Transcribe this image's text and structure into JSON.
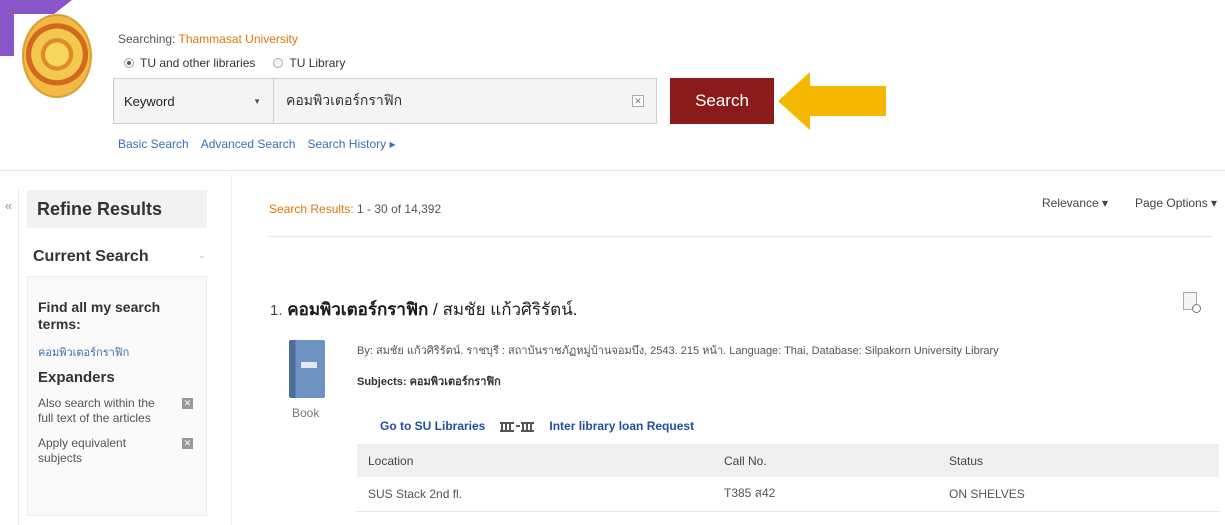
{
  "header": {
    "searching_label": "Searching:",
    "institution": "Thammasat University",
    "scope_options": [
      {
        "label": "TU and other libraries",
        "selected": true
      },
      {
        "label": "TU Library",
        "selected": false
      }
    ],
    "field_select": "Keyword",
    "query": "คอมพิวเตอร์กราฟิก",
    "search_button": "Search",
    "links": [
      "Basic Search",
      "Advanced Search",
      "Search History ▸"
    ]
  },
  "sidebar": {
    "title": "Refine Results",
    "current_search": "Current Search",
    "find_all": "Find all my search terms:",
    "term": "คอมพิวเตอร์กราฟิก",
    "expanders_title": "Expanders",
    "expanders": [
      "Also search within the full text of the articles",
      "Apply equivalent subjects"
    ]
  },
  "results": {
    "summary_label": "Search Results:",
    "summary_range": "1 - 30 of 14,392",
    "sort": "Relevance ▾",
    "page_options": "Page Options ▾",
    "items": [
      {
        "number": "1.",
        "title": "คอมพิวเตอร์กราฟิก",
        "author": " / สมชัย แก้วศิริรัตน์.",
        "byline": "By: สมชัย แก้วศิริรัตน์. ราชบุรี : สถาบันราชภัฏหมู่บ้านจอมบึง, 2543. 215 หน้า. Language: Thai, Database: Silpakorn University Library",
        "subjects": "Subjects: คอมพิวเตอร์กราฟิก",
        "format": "Book",
        "link_su": "Go to SU Libraries",
        "link_ill": "Inter library loan Request",
        "table_headers": [
          "Location",
          "Call No.",
          "Status"
        ],
        "table_rows": [
          [
            "SUS Stack 2nd fl.",
            "T385 ส42",
            "ON SHELVES"
          ]
        ]
      }
    ]
  },
  "colors": {
    "search_button": "#8b1a1a",
    "arrow": "#f5b700",
    "institution": "#e0760c",
    "link": "#3b6fb0"
  }
}
